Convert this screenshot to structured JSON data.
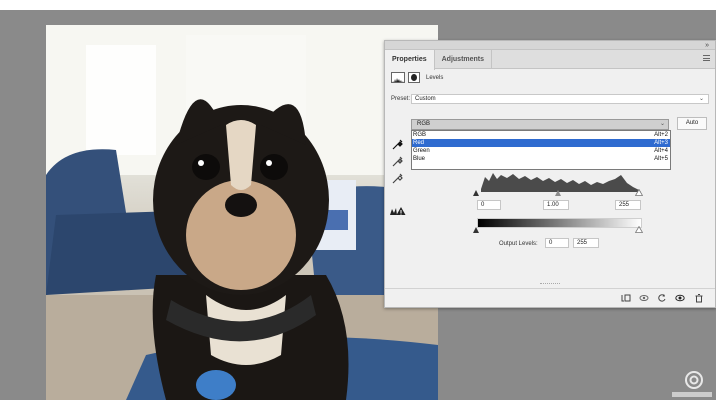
{
  "panel": {
    "collapse_icon": "»",
    "tabs": [
      {
        "label": "Properties",
        "active": true
      },
      {
        "label": "Adjustments",
        "active": false
      }
    ],
    "header_label": "Levels",
    "preset_label": "Preset:",
    "preset_value": "Custom",
    "channel_value": "RGB",
    "auto_label": "Auto",
    "channel_options": [
      {
        "label": "RGB",
        "shortcut": "Alt+2",
        "selected": false
      },
      {
        "label": "Red",
        "shortcut": "Alt+3",
        "selected": true
      },
      {
        "label": "Green",
        "shortcut": "Alt+4",
        "selected": false
      },
      {
        "label": "Blue",
        "shortcut": "Alt+5",
        "selected": false
      }
    ],
    "input_levels": {
      "black": "0",
      "midtone": "1.00",
      "white": "255"
    },
    "output_label": "Output Levels:",
    "output_levels": {
      "black": "0",
      "white": "255"
    },
    "footer_icons": [
      "clip-to-layer-icon",
      "view-previous-state-icon",
      "reset-icon",
      "visibility-eye-icon",
      "delete-icon"
    ]
  },
  "colors": {
    "selection": "#2f6bd0",
    "panel_bg": "#f0f0f0",
    "workspace_bg": "#8a8a8a"
  }
}
